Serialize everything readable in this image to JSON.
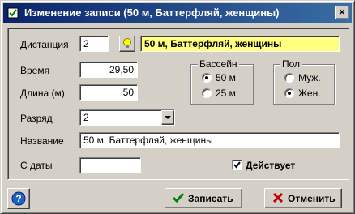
{
  "window": {
    "title": "Изменение записи  (50 м, Баттерфляй, женщины)",
    "close_glyph": "×"
  },
  "form": {
    "distance": {
      "label": "Дистанция",
      "value": "2",
      "description": "50 м, Баттерфляй, женщины"
    },
    "time": {
      "label": "Время",
      "value": "29,50"
    },
    "length": {
      "label": "Длина (м)",
      "value": "50"
    },
    "rank": {
      "label": "Разряд",
      "value": "2"
    },
    "name": {
      "label": "Название",
      "value": "50 м, Баттерфляй, женщины"
    },
    "from_date": {
      "label": "С даты",
      "value": ""
    },
    "active": {
      "label": "Действует",
      "checked": true
    }
  },
  "pool": {
    "title": "Бассейн",
    "options": [
      "50 м",
      "25 м"
    ],
    "selected": "50 м"
  },
  "gender": {
    "title": "Пол",
    "options": [
      "Муж.",
      "Жен."
    ],
    "selected": "Жен."
  },
  "buttons": {
    "save": "Записать",
    "cancel": "Отменить",
    "help": "?"
  }
}
